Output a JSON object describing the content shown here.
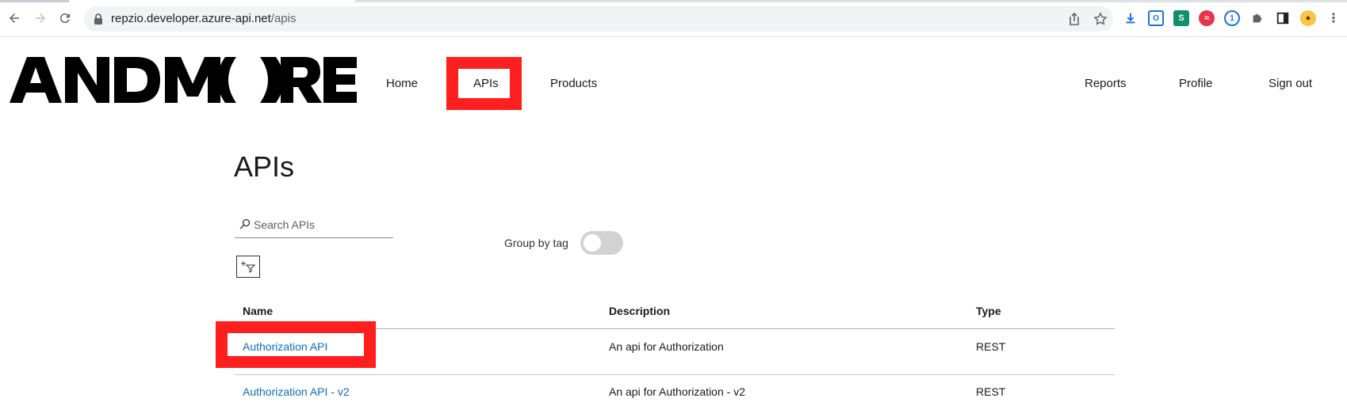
{
  "browser": {
    "url_host": "repzio.developer.azure-api.net",
    "url_path": "/apis",
    "extensions": [
      {
        "name": "download-icon",
        "color": "#1a73e8"
      },
      {
        "name": "outlook-ext-icon",
        "color": "#1a73e8"
      },
      {
        "name": "s-ext-icon",
        "color": "#0f9d58",
        "label": "S"
      },
      {
        "name": "red-ext-icon",
        "color": "#ea4335"
      },
      {
        "name": "onepassword-icon",
        "color": "#1a73e8"
      },
      {
        "name": "puzzle-icon",
        "color": "#5f6368"
      },
      {
        "name": "sidepanel-icon",
        "color": "#202124"
      },
      {
        "name": "avatar-icon",
        "color": "#f6c744"
      }
    ]
  },
  "header": {
    "logo_text": "ANDMORE",
    "nav_home": "Home",
    "nav_apis": "APIs",
    "nav_products": "Products",
    "nav_reports": "Reports",
    "nav_profile": "Profile",
    "nav_signout": "Sign out"
  },
  "main": {
    "title": "APIs",
    "search_placeholder": "Search APIs",
    "group_by_tag_label": "Group by tag",
    "group_by_tag_on": false,
    "table": {
      "headers": [
        "Name",
        "Description",
        "Type"
      ],
      "rows": [
        {
          "name": "Authorization API",
          "description": "An api for Authorization",
          "type": "REST"
        },
        {
          "name": "Authorization API - v2",
          "description": "An api for Authorization - v2",
          "type": "REST"
        }
      ]
    }
  },
  "colors": {
    "highlight": "#ff1f1f",
    "link": "#0f6cbd"
  }
}
